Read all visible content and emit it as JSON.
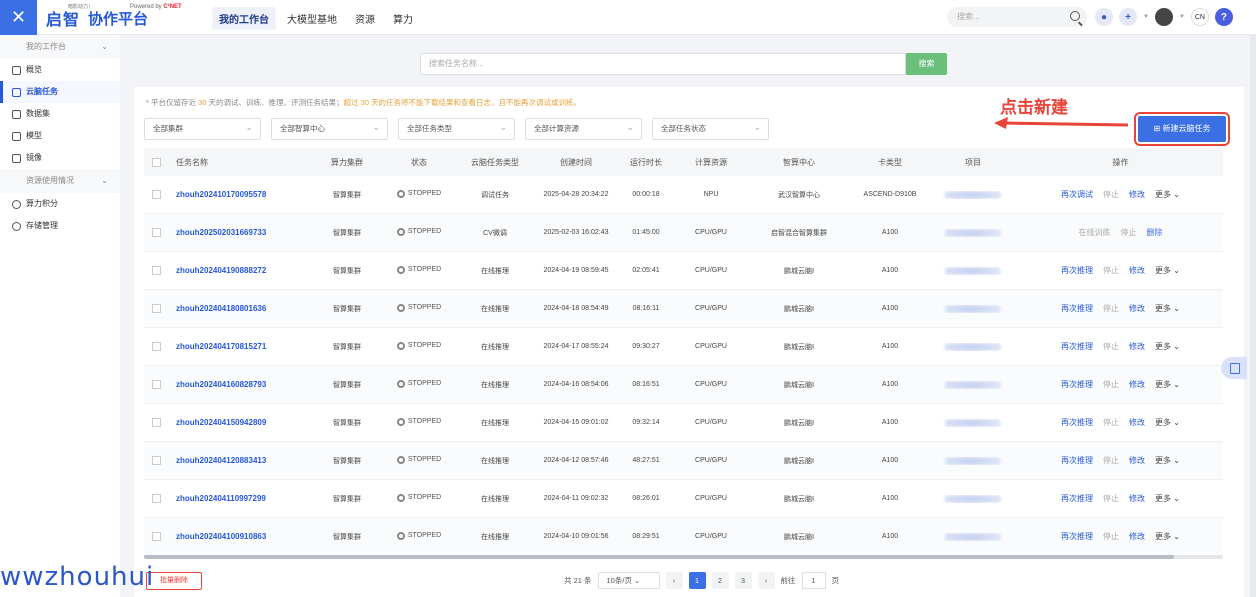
{
  "header": {
    "logo_tagline": "暗影动力！",
    "logo_main": "启智",
    "logo_powered": "Powered by",
    "logo_powered_brand": "C²NET",
    "logo_sub": "协作平台",
    "nav": [
      "我的工作台",
      "大模型基地",
      "资源",
      "算力"
    ],
    "search_placeholder": "搜索...",
    "lang": "CN",
    "help": "?"
  },
  "sidebar": {
    "group1": "我的工作台",
    "items1": [
      "概览",
      "云脑任务",
      "数据集",
      "模型",
      "镜像"
    ],
    "group2": "资源使用情况",
    "items2": [
      "算力积分",
      "存储管理"
    ]
  },
  "main": {
    "search_placeholder": "搜索任务名称...",
    "search_button": "搜索",
    "notice_prefix": "* 平台仅留存近",
    "notice_days": "30",
    "notice_mid": "天的调试、训练、推理、评测任务结果；",
    "notice_warn": "超过 30 天的任务将不能下载结果和查看日志，且不能再次调试或训练。",
    "filters": [
      "全部集群",
      "全部智算中心",
      "全部任务类型",
      "全部计算资源",
      "全部任务状态"
    ],
    "new_button": "⊞ 新建云脑任务",
    "annotation": "点击新建"
  },
  "table": {
    "headers": [
      "任务名称",
      "算力集群",
      "状态",
      "云脑任务类型",
      "创建时间",
      "运行时长",
      "计算资源",
      "智算中心",
      "卡类型",
      "项目",
      "操作"
    ],
    "rows": [
      {
        "name": "zhouh202410170095578",
        "cluster": "智算集群",
        "status": "STOPPED",
        "type": "调试任务",
        "created": "2025-04-28 20:34:22",
        "duration": "00:00:18",
        "resource": "NPU",
        "center": "武汉智算中心",
        "card": "ASCEND-D910B",
        "ops": [
          "再次调试",
          "停止",
          "修改",
          "更多 ⌄"
        ]
      },
      {
        "name": "zhouh202502031669733",
        "cluster": "智算集群",
        "status": "STOPPED",
        "type": "CV微调",
        "created": "2025-02-03 16:02:43",
        "duration": "01:45:00",
        "resource": "CPU/GPU",
        "center": "启智混合智算集群",
        "card": "A100",
        "ops": [
          "在线训练",
          "停止",
          "删除"
        ]
      },
      {
        "name": "zhouh202404190888272",
        "cluster": "智算集群",
        "status": "STOPPED",
        "type": "在线推理",
        "created": "2024-04-19 08:59:45",
        "duration": "02:05:41",
        "resource": "CPU/GPU",
        "center": "鹏城云脑Ⅰ",
        "card": "A100",
        "ops": [
          "再次推理",
          "停止",
          "修改",
          "更多 ⌄"
        ]
      },
      {
        "name": "zhouh202404180801636",
        "cluster": "智算集群",
        "status": "STOPPED",
        "type": "在线推理",
        "created": "2024-04-18 08:54:49",
        "duration": "08:16:11",
        "resource": "CPU/GPU",
        "center": "鹏城云脑Ⅰ",
        "card": "A100",
        "ops": [
          "再次推理",
          "停止",
          "修改",
          "更多 ⌄"
        ]
      },
      {
        "name": "zhouh202404170815271",
        "cluster": "智算集群",
        "status": "STOPPED",
        "type": "在线推理",
        "created": "2024-04-17 08:55:24",
        "duration": "09:30:27",
        "resource": "CPU/GPU",
        "center": "鹏城云脑Ⅰ",
        "card": "A100",
        "ops": [
          "再次推理",
          "停止",
          "修改",
          "更多 ⌄"
        ]
      },
      {
        "name": "zhouh202404160828793",
        "cluster": "智算集群",
        "status": "STOPPED",
        "type": "在线推理",
        "created": "2024-04-16 08:54:06",
        "duration": "08:16:51",
        "resource": "CPU/GPU",
        "center": "鹏城云脑Ⅰ",
        "card": "A100",
        "ops": [
          "再次推理",
          "停止",
          "修改",
          "更多 ⌄"
        ]
      },
      {
        "name": "zhouh202404150942809",
        "cluster": "智算集群",
        "status": "STOPPED",
        "type": "在线推理",
        "created": "2024-04-15 09:01:02",
        "duration": "09:32:14",
        "resource": "CPU/GPU",
        "center": "鹏城云脑Ⅰ",
        "card": "A100",
        "ops": [
          "再次推理",
          "停止",
          "修改",
          "更多 ⌄"
        ]
      },
      {
        "name": "zhouh202404120883413",
        "cluster": "智算集群",
        "status": "STOPPED",
        "type": "在线推理",
        "created": "2024-04-12 08:57:46",
        "duration": "48:27:51",
        "resource": "CPU/GPU",
        "center": "鹏城云脑Ⅰ",
        "card": "A100",
        "ops": [
          "再次推理",
          "停止",
          "修改",
          "更多 ⌄"
        ]
      },
      {
        "name": "zhouh202404110997299",
        "cluster": "智算集群",
        "status": "STOPPED",
        "type": "在线推理",
        "created": "2024-04-11 09:02:32",
        "duration": "08:26:01",
        "resource": "CPU/GPU",
        "center": "鹏城云脑Ⅰ",
        "card": "A100",
        "ops": [
          "再次推理",
          "停止",
          "修改",
          "更多 ⌄"
        ]
      },
      {
        "name": "zhouh202404100910863",
        "cluster": "智算集群",
        "status": "STOPPED",
        "type": "在线推理",
        "created": "2024-04-10 09:01:56",
        "duration": "08:29:51",
        "resource": "CPU/GPU",
        "center": "鹏城云脑Ⅰ",
        "card": "A100",
        "ops": [
          "再次推理",
          "停止",
          "修改",
          "更多 ⌄"
        ]
      }
    ]
  },
  "footer": {
    "batch_delete": "批量删除",
    "total": "共 21 条",
    "page_size": "10条/页 ⌄",
    "pages": [
      "1",
      "2",
      "3"
    ],
    "prev": "‹",
    "next": "›",
    "goto_label": "前往",
    "goto_value": "1",
    "goto_suffix": "页"
  },
  "watermark": "wwzhouhui",
  "colors": {
    "primary": "#3b6fe4",
    "annotation": "#e8443a",
    "search_green": "#6abf7b"
  }
}
